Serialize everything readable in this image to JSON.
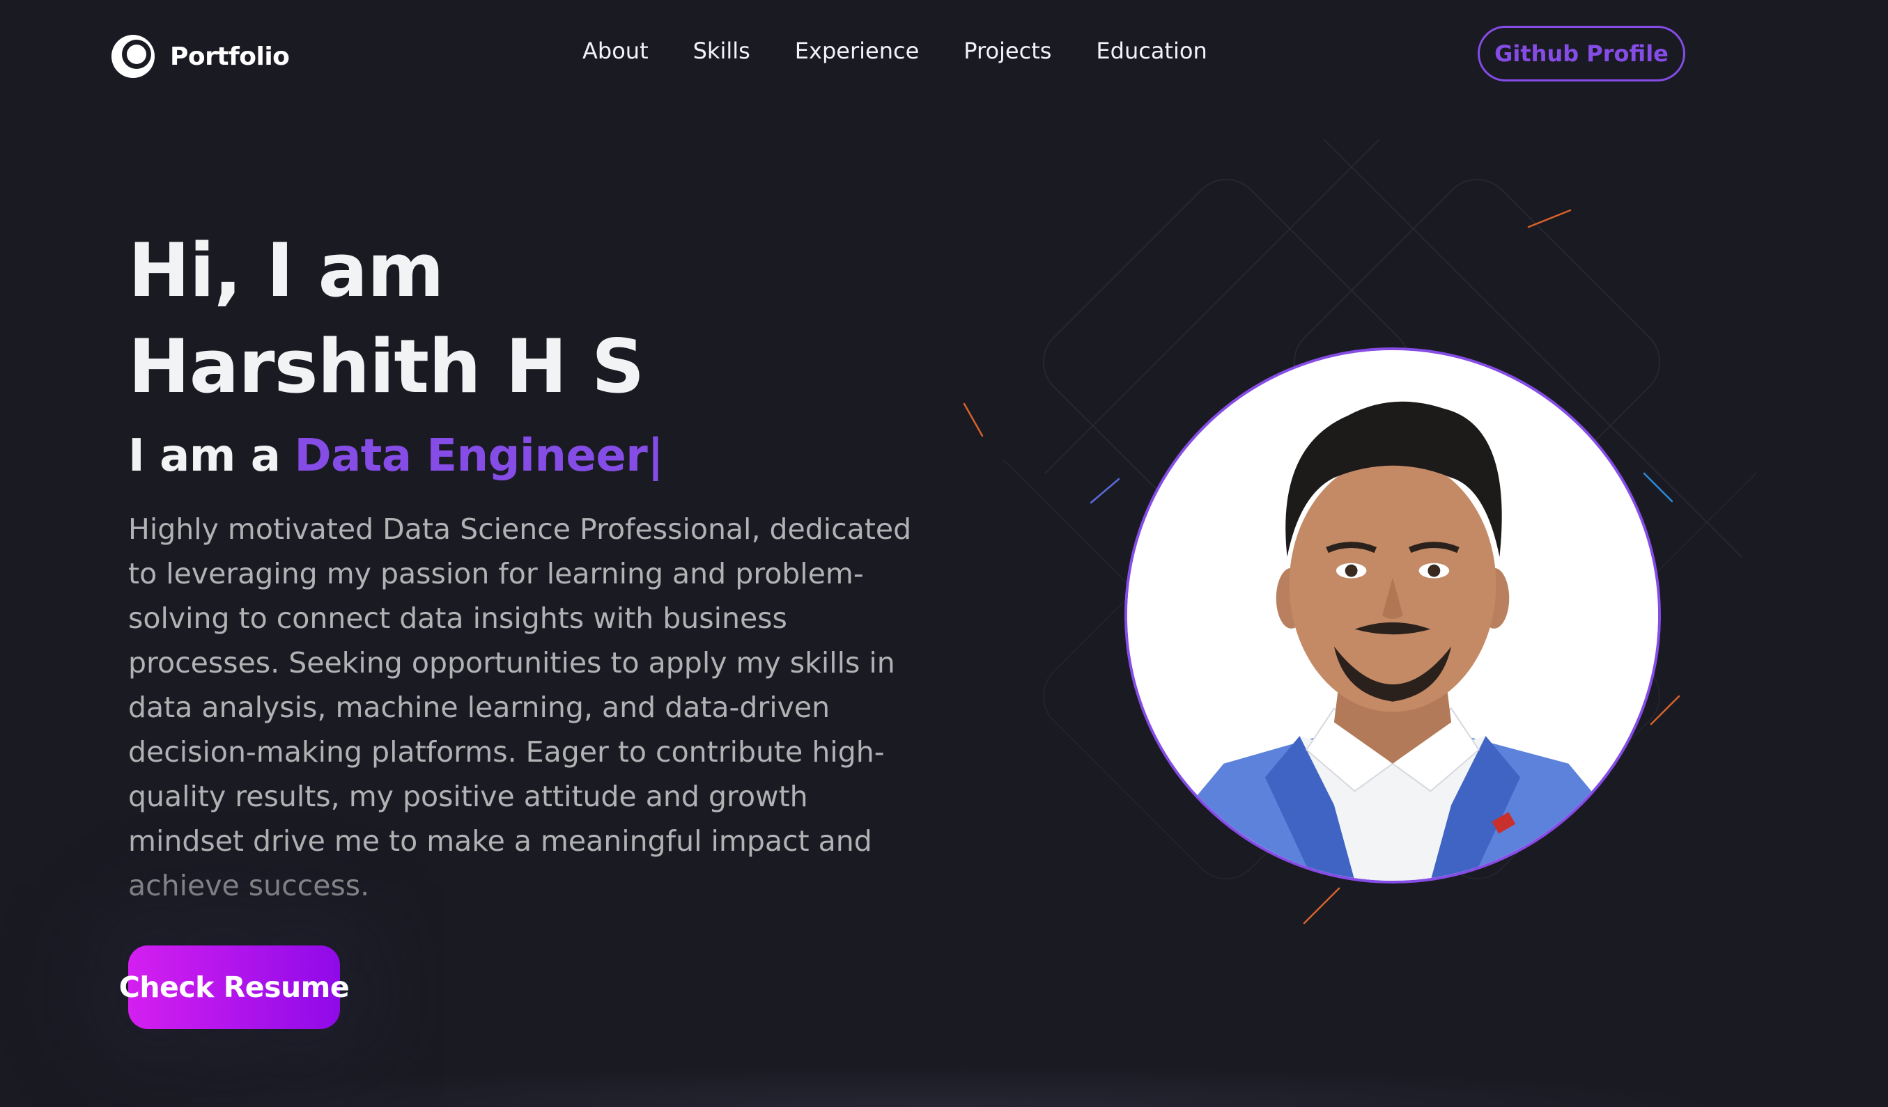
{
  "nav": {
    "logo_text": "Portfolio",
    "links": [
      "About",
      "Skills",
      "Experience",
      "Projects",
      "Education"
    ],
    "github_label": "Github Profile"
  },
  "hero": {
    "greeting": "Hi, I am",
    "name": "Harshith H S",
    "role_prefix": "I am a",
    "role": "Data Engineer",
    "cursor": "|",
    "bio": "Highly motivated Data Science Professional, dedicated to leveraging my passion for learning and problem-solving to connect data insights with business processes. Seeking opportunities to apply my skills in data analysis, machine learning, and data-driven decision-making platforms. Eager to contribute high-quality results, my positive attitude and growth mindset drive me to make a meaningful impact and",
    "bio_end": "achieve success.",
    "resume_label": "Check Resume"
  },
  "colors": {
    "background": "#1a1a23",
    "accent": "#854ce6",
    "button_gradient_start": "#d41ff0",
    "button_gradient_end": "#8f0ae8",
    "text_primary": "#f2f3f4",
    "text_secondary": "#b1b2b3"
  },
  "icons": {
    "logo": "portfolio-logo-icon"
  }
}
